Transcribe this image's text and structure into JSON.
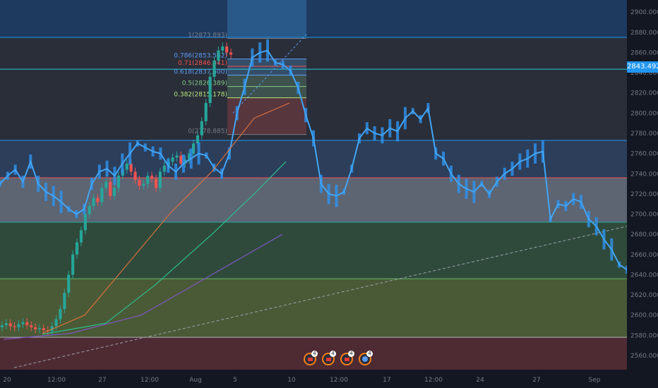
{
  "chart_data": {
    "type": "candlestick",
    "price_axis": {
      "ticks": [
        "2900.000",
        "2880.000",
        "2860.000",
        "2840.000",
        "2820.000",
        "2800.000",
        "2780.000",
        "2760.000",
        "2740.000",
        "2720.000",
        "2700.000",
        "2680.000",
        "2660.000",
        "2640.000",
        "2620.000",
        "2600.000",
        "2580.000",
        "2560.000"
      ],
      "range": [
        2546,
        2912
      ]
    },
    "time_axis": {
      "ticks": [
        "20",
        "12:00",
        "27",
        "12:00",
        "Aug",
        "5",
        "10",
        "12:00",
        "17",
        "12:00",
        "24",
        "27",
        "Sep"
      ]
    },
    "last_price": "2843.492",
    "last_price_value": 2843.492,
    "horizontal_levels": [
      {
        "price": 2875,
        "color": "#2196f3"
      },
      {
        "price": 2843.5,
        "color": "#26c6da"
      },
      {
        "price": 2773,
        "color": "#2196f3"
      },
      {
        "price": 2736,
        "color": "#ef5350"
      },
      {
        "price": 2692,
        "color": "#26a69a"
      },
      {
        "price": 2636,
        "color": "#66bb6a"
      },
      {
        "price": 2578,
        "color": "#b2b5be"
      }
    ],
    "zones": [
      {
        "from": 2912,
        "to": 2875,
        "color": "#1e3a5f"
      },
      {
        "from": 2875,
        "to": 2773,
        "color": "#2a2e39"
      },
      {
        "from": 2773,
        "to": 2736,
        "color": "#2c3e5a"
      },
      {
        "from": 2736,
        "to": 2692,
        "color": "#5d6472"
      },
      {
        "from": 2692,
        "to": 2636,
        "color": "#2f4a3b"
      },
      {
        "from": 2636,
        "to": 2578,
        "color": "#4a5a36"
      },
      {
        "from": 2578,
        "to": 2546,
        "color": "#4e2b33"
      }
    ],
    "fibonacci": {
      "levels": [
        {
          "label": "1(2873.893)",
          "value": 2873.893,
          "color": "#787b86"
        },
        {
          "label": "0.786(2853.562)",
          "value": 2853.562,
          "color": "#5b9cf6"
        },
        {
          "label": "0.71(2846.341)",
          "value": 2846.341,
          "color": "#ef5350"
        },
        {
          "label": "0.618(2837.600)",
          "value": 2837.6,
          "color": "#5b9cf6"
        },
        {
          "label": "0.5(2826.389)",
          "value": 2826.389,
          "color": "#81c784"
        },
        {
          "label": "0.382(2815.178)",
          "value": 2815.178,
          "color": "#b5e77d"
        },
        {
          "label": "0(2778.885)",
          "value": 2778.885,
          "color": "#787b86"
        }
      ]
    },
    "series": [
      {
        "kind": "candles-green-red",
        "from_x": 0,
        "to_x": 330,
        "close": [
          2590,
          2592,
          2589,
          2588,
          2591,
          2593,
          2590,
          2588,
          2586,
          2587,
          2585,
          2584,
          2589,
          2596,
          2606,
          2622,
          2640,
          2660,
          2672,
          2684,
          2700,
          2708,
          2716,
          2712,
          2726,
          2732,
          2718,
          2726,
          2738,
          2744,
          2750,
          2742,
          2734,
          2728,
          2730,
          2738,
          2735,
          2726,
          2742,
          2748,
          2752,
          2756,
          2758,
          2750,
          2754,
          2760,
          2770,
          2778,
          2792,
          2810,
          2836,
          2852,
          2862,
          2866,
          2860,
          2858
        ]
      },
      {
        "kind": "line-blue",
        "from_x": 0,
        "to_x": 888,
        "close": [
          2730,
          2738,
          2744,
          2732,
          2752,
          2730,
          2722,
          2718,
          2712,
          2705,
          2700,
          2705,
          2730,
          2742,
          2745,
          2738,
          2750,
          2760,
          2770,
          2766,
          2762,
          2760,
          2748,
          2742,
          2750,
          2755,
          2760,
          2758,
          2746,
          2740,
          2760,
          2800,
          2826,
          2855,
          2860,
          2862,
          2850,
          2848,
          2842,
          2825,
          2798,
          2775,
          2730,
          2720,
          2718,
          2722,
          2745,
          2775,
          2785,
          2780,
          2778,
          2785,
          2782,
          2795,
          2802,
          2794,
          2805,
          2760,
          2755,
          2740,
          2730,
          2725,
          2722,
          2730,
          2720,
          2732,
          2740,
          2745,
          2752,
          2755,
          2760,
          2762,
          2695,
          2710,
          2708,
          2715,
          2712,
          2695,
          2688,
          2675,
          2665,
          2650,
          2645
        ]
      },
      {
        "kind": "ma-orange",
        "points": [
          [
            60,
            2582
          ],
          [
            120,
            2600
          ],
          [
            180,
            2650
          ],
          [
            240,
            2700
          ],
          [
            300,
            2742
          ],
          [
            360,
            2795
          ],
          [
            410,
            2810
          ]
        ]
      },
      {
        "kind": "ma-green",
        "points": [
          [
            60,
            2581
          ],
          [
            150,
            2592
          ],
          [
            220,
            2630
          ],
          [
            300,
            2680
          ],
          [
            360,
            2720
          ],
          [
            405,
            2752
          ]
        ]
      },
      {
        "kind": "ma-purple",
        "points": [
          [
            5,
            2576
          ],
          [
            100,
            2582
          ],
          [
            200,
            2600
          ],
          [
            300,
            2640
          ],
          [
            400,
            2680
          ]
        ]
      }
    ],
    "trendline": {
      "from": [
        20,
        2548
      ],
      "to": [
        888,
        2688
      ],
      "color": "#9aa0ab"
    },
    "events": [
      {
        "icon": "calendar-event-icon",
        "count": "4"
      },
      {
        "icon": "calendar-event-icon",
        "count": "4"
      },
      {
        "icon": "calendar-event-icon",
        "count": "4"
      },
      {
        "icon": "calendar-event-icon",
        "count": "4"
      }
    ]
  }
}
